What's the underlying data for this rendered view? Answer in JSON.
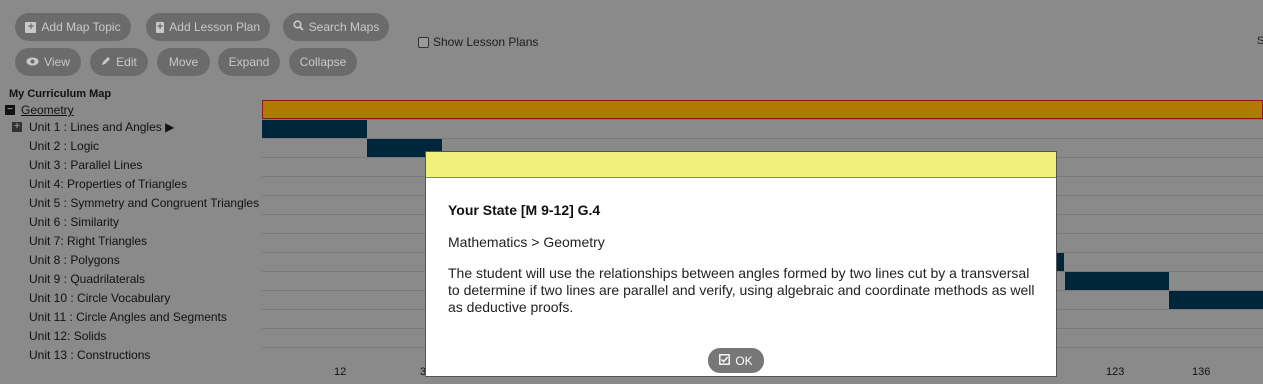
{
  "toolbar": {
    "add_map_topic": "Add Map Topic",
    "add_lesson_plan": "Add Lesson Plan",
    "search_maps": "Search Maps",
    "view": "View",
    "edit": "Edit",
    "move": "Move",
    "expand": "Expand",
    "collapse": "Collapse",
    "show_lesson_plans": "Show Lesson Plans"
  },
  "tree": {
    "title": "My Curriculum Map",
    "root": "Geometry",
    "units": [
      "Unit 1 : Lines and Angles ▶",
      "Unit 2 : Logic",
      "Unit 3 : Parallel Lines",
      "Unit 4: Properties of Triangles",
      "Unit 5 : Symmetry and Congruent Triangles",
      "Unit 6 : Similarity",
      "Unit 7: Right Triangles",
      "Unit 8 : Polygons",
      "Unit 9 : Quadrilaterals",
      "Unit 10 : Circle Vocabulary",
      "Unit 11 : Circle Angles and Segments",
      "Unit 12: Solids",
      "Unit 13 : Constructions"
    ]
  },
  "axis": {
    "labels": [
      "12",
      "3",
      "123",
      "136"
    ]
  },
  "modal": {
    "title": "Your State [M 9-12] G.4",
    "path": "Mathematics > Geometry",
    "description": "The student will use the relationships between angles formed by two lines cut by a transversal to determine if two lines are parallel and verify, using algebraic and coordinate methods as well as deductive proofs.",
    "ok_label": "OK"
  },
  "colors": {
    "geometry_bar": "#b07a00",
    "unit_segment": "#00263c",
    "modal_header": "#f0f07a"
  }
}
